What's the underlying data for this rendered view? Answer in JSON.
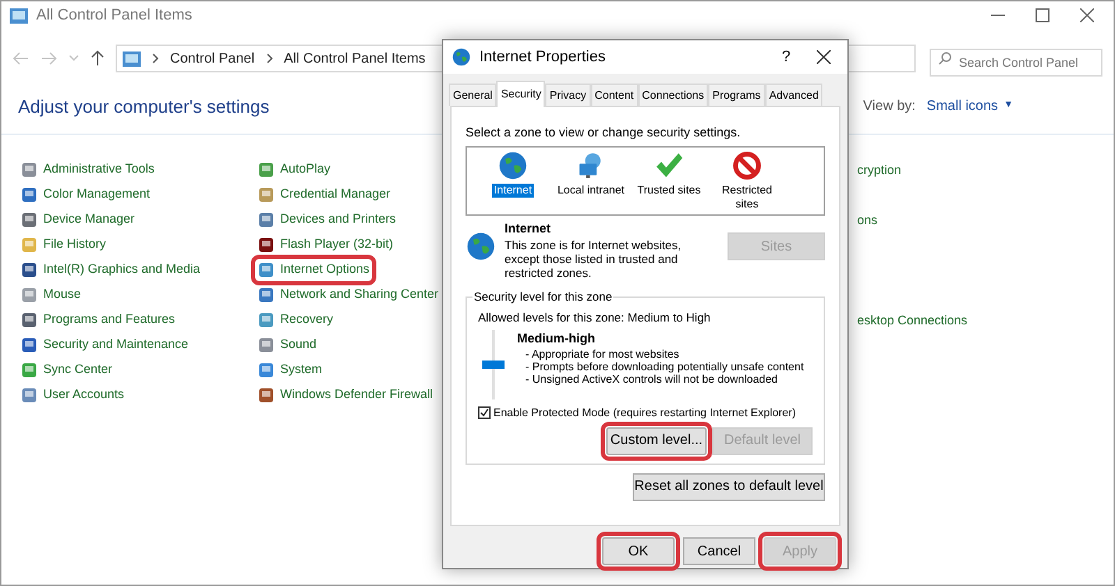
{
  "window": {
    "title": "All Control Panel Items"
  },
  "address_bar": {
    "path": [
      "Control Panel",
      "All Control Panel Items"
    ]
  },
  "search": {
    "placeholder": "Search Control Panel"
  },
  "heading": "Adjust your computer's settings",
  "view_by": {
    "label": "View by:",
    "value": "Small icons",
    "caret": "▼"
  },
  "columns": [
    {
      "items": [
        {
          "label": "Administrative Tools",
          "color": "#8a8f99",
          "highlighted": false
        },
        {
          "label": "Color Management",
          "color": "#2f6fc0",
          "highlighted": false
        },
        {
          "label": "Device Manager",
          "color": "#6b6f76",
          "highlighted": false
        },
        {
          "label": "File History",
          "color": "#e0b64a",
          "highlighted": false
        },
        {
          "label": "Intel(R) Graphics and Media",
          "color": "#2b4f8c",
          "highlighted": false
        },
        {
          "label": "Mouse",
          "color": "#9aa0a8",
          "highlighted": false
        },
        {
          "label": "Programs and Features",
          "color": "#5a6270",
          "highlighted": false
        },
        {
          "label": "Security and Maintenance",
          "color": "#2a5db8",
          "highlighted": false
        },
        {
          "label": "Sync Center",
          "color": "#3aa845",
          "highlighted": false
        },
        {
          "label": "User Accounts",
          "color": "#6a8cb8",
          "highlighted": false
        }
      ]
    },
    {
      "items": [
        {
          "label": "AutoPlay",
          "color": "#4aa04a",
          "highlighted": false
        },
        {
          "label": "Credential Manager",
          "color": "#b89a5a",
          "highlighted": false
        },
        {
          "label": "Devices and Printers",
          "color": "#5b7fa8",
          "highlighted": false
        },
        {
          "label": "Flash Player (32-bit)",
          "color": "#7a1010",
          "highlighted": false
        },
        {
          "label": "Internet Options",
          "color": "#3f8fc8",
          "highlighted": true
        },
        {
          "label": "Network and Sharing Center",
          "color": "#3a78c0",
          "highlighted": false
        },
        {
          "label": "Recovery",
          "color": "#4a9ac0",
          "highlighted": false
        },
        {
          "label": "Sound",
          "color": "#8a8f99",
          "highlighted": false
        },
        {
          "label": "System",
          "color": "#3a88d8",
          "highlighted": false
        },
        {
          "label": "Windows Defender Firewall",
          "color": "#a0502a",
          "highlighted": false
        }
      ]
    },
    {
      "items": [
        {
          "label": "cryption"
        },
        {
          "label": "ons"
        },
        {
          "label": "esktop Connections"
        }
      ]
    }
  ],
  "dialog": {
    "title": "Internet Properties",
    "help": "?",
    "tabs": [
      {
        "label": "General",
        "selected": false
      },
      {
        "label": "Security",
        "selected": true
      },
      {
        "label": "Privacy",
        "selected": false
      },
      {
        "label": "Content",
        "selected": false
      },
      {
        "label": "Connections",
        "selected": false
      },
      {
        "label": "Programs",
        "selected": false
      },
      {
        "label": "Advanced",
        "selected": false
      }
    ],
    "zone_prompt": "Select a zone to view or change security settings.",
    "zones": [
      {
        "label": "Internet",
        "kind": "globe",
        "selected": true
      },
      {
        "label": "Local intranet",
        "kind": "network",
        "selected": false
      },
      {
        "label": "Trusted sites",
        "kind": "check",
        "selected": false
      },
      {
        "label": "Restricted sites",
        "kind": "blocked",
        "selected": false
      }
    ],
    "zone_info": {
      "name": "Internet",
      "description": "This zone is for Internet websites, except those listed in trusted and restricted zones."
    },
    "sites_button": {
      "label": "Sites",
      "disabled": true
    },
    "security_group": {
      "title": "Security level for this zone",
      "allowed": "Allowed levels for this zone: Medium to High",
      "level": 0.5,
      "level_name": "Medium-high",
      "bullets": [
        "- Appropriate for most websites",
        "- Prompts before downloading potentially unsafe content",
        "- Unsigned ActiveX controls will not be downloaded"
      ],
      "protected_mode": {
        "label": "Enable Protected Mode (requires restarting Internet Explorer)",
        "checked": true
      },
      "buttons": [
        {
          "label": "Custom level...",
          "disabled": false,
          "highlighted": true
        },
        {
          "label": "Default level",
          "disabled": true,
          "highlighted": false
        }
      ]
    },
    "reset_button": {
      "label": "Reset all zones to default level",
      "disabled": false
    },
    "footer_buttons": [
      {
        "label": "OK",
        "disabled": false,
        "highlighted": true
      },
      {
        "label": "Cancel",
        "disabled": false,
        "highlighted": false
      },
      {
        "label": "Apply",
        "disabled": true,
        "highlighted": true
      }
    ]
  }
}
